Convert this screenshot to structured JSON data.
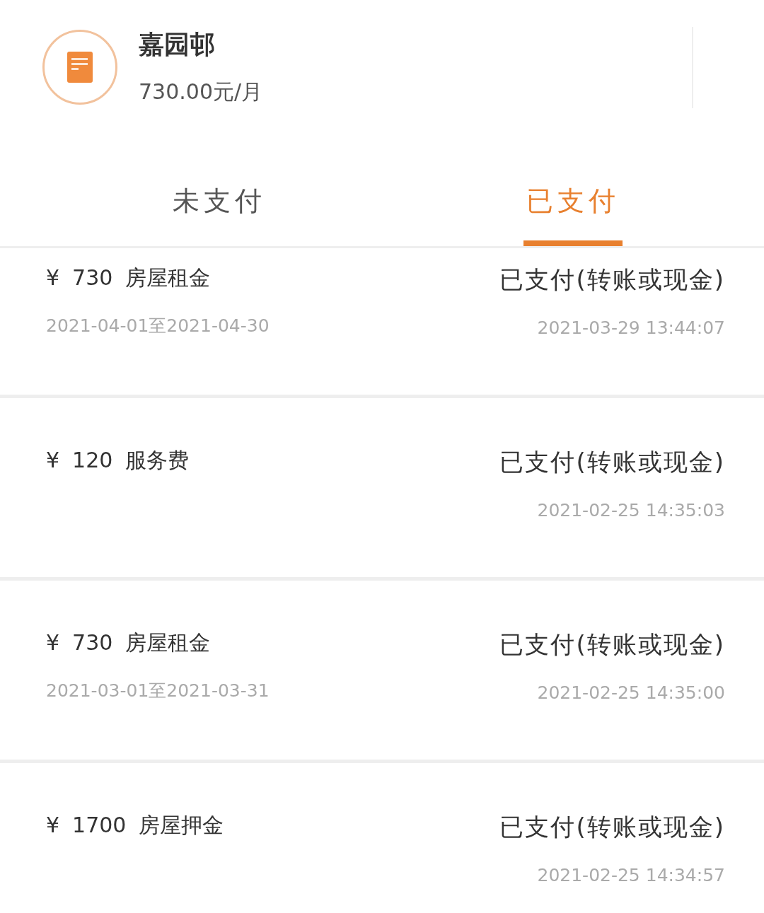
{
  "header": {
    "name": "嘉园邨",
    "price": "730.00元/月"
  },
  "tabs": [
    {
      "label": "未支付",
      "selected": false
    },
    {
      "label": "已支付",
      "selected": true
    }
  ],
  "bills": [
    {
      "currency": "¥",
      "amount": "730",
      "item": "房屋租金",
      "period": "2021-04-01至2021-04-30",
      "status": "已支付(转账或现金)",
      "paid_at": "2021-03-29 13:44:07"
    },
    {
      "currency": "¥",
      "amount": "120",
      "item": "服务费",
      "status": "已支付(转账或现金)",
      "paid_at": "2021-02-25 14:35:03"
    },
    {
      "currency": "¥",
      "amount": "730",
      "item": "房屋租金",
      "period": "2021-03-01至2021-03-31",
      "status": "已支付(转账或现金)",
      "paid_at": "2021-02-25 14:35:00"
    },
    {
      "currency": "¥",
      "amount": "1700",
      "item": "房屋押金",
      "status": "已支付(转账或现金)",
      "paid_at": "2021-02-25 14:34:57"
    }
  ]
}
